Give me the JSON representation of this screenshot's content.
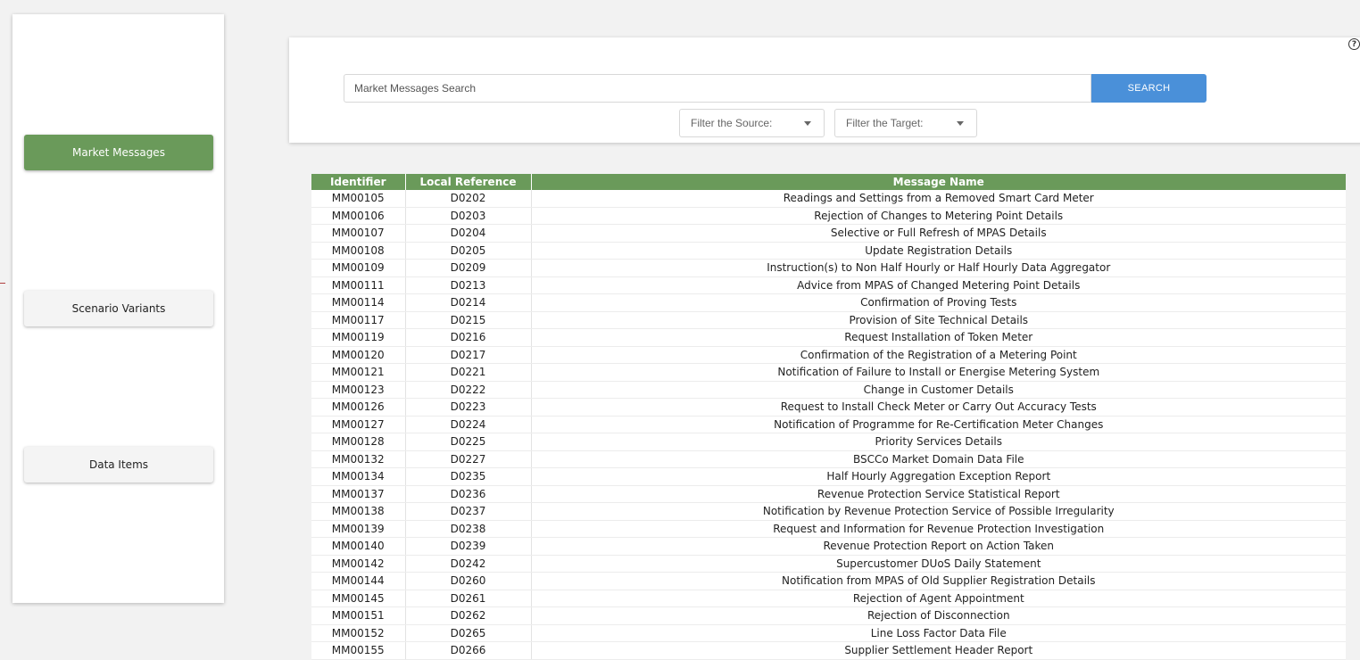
{
  "sidebar": {
    "items": [
      {
        "label": "Market Messages",
        "active": true
      },
      {
        "label": "Scenario Variants",
        "active": false
      },
      {
        "label": "Data Items",
        "active": false
      }
    ]
  },
  "search": {
    "placeholder": "Market Messages Search",
    "button_label": "SEARCH",
    "filter_source_label": "Filter the Source:",
    "filter_target_label": "Filter the Target:"
  },
  "help_icon": "help-icon",
  "colors": {
    "accent_green": "#6a9a5a",
    "search_blue": "#4a90d9"
  },
  "table": {
    "columns": [
      "Identifier",
      "Local Reference",
      "Message Name"
    ],
    "rows": [
      [
        "MM00105",
        "D0202",
        "Readings and Settings from a Removed Smart Card Meter"
      ],
      [
        "MM00106",
        "D0203",
        "Rejection of Changes to Metering Point Details"
      ],
      [
        "MM00107",
        "D0204",
        "Selective or Full Refresh of MPAS Details"
      ],
      [
        "MM00108",
        "D0205",
        "Update Registration Details"
      ],
      [
        "MM00109",
        "D0209",
        "Instruction(s) to Non Half Hourly or Half Hourly Data Aggregator"
      ],
      [
        "MM00111",
        "D0213",
        "Advice from MPAS of Changed Metering Point Details"
      ],
      [
        "MM00114",
        "D0214",
        "Confirmation of Proving Tests"
      ],
      [
        "MM00117",
        "D0215",
        "Provision of Site Technical Details"
      ],
      [
        "MM00119",
        "D0216",
        "Request Installation of Token Meter"
      ],
      [
        "MM00120",
        "D0217",
        "Confirmation of the Registration of a Metering Point"
      ],
      [
        "MM00121",
        "D0221",
        "Notification of Failure to Install or Energise Metering System"
      ],
      [
        "MM00123",
        "D0222",
        "Change in Customer Details"
      ],
      [
        "MM00126",
        "D0223",
        "Request to Install Check Meter or Carry Out Accuracy Tests"
      ],
      [
        "MM00127",
        "D0224",
        "Notification of Programme for Re-Certification Meter Changes"
      ],
      [
        "MM00128",
        "D0225",
        "Priority Services Details"
      ],
      [
        "MM00132",
        "D0227",
        "BSCCo Market Domain Data File"
      ],
      [
        "MM00134",
        "D0235",
        "Half Hourly Aggregation Exception Report"
      ],
      [
        "MM00137",
        "D0236",
        "Revenue Protection Service Statistical Report"
      ],
      [
        "MM00138",
        "D0237",
        "Notification by Revenue Protection Service of Possible Irregularity"
      ],
      [
        "MM00139",
        "D0238",
        "Request and Information for Revenue Protection Investigation"
      ],
      [
        "MM00140",
        "D0239",
        "Revenue Protection Report on Action Taken"
      ],
      [
        "MM00142",
        "D0242",
        "Supercustomer DUoS Daily Statement"
      ],
      [
        "MM00144",
        "D0260",
        "Notification from MPAS of Old Supplier Registration Details"
      ],
      [
        "MM00145",
        "D0261",
        "Rejection of Agent Appointment"
      ],
      [
        "MM00151",
        "D0262",
        "Rejection of Disconnection"
      ],
      [
        "MM00152",
        "D0265",
        "Line Loss Factor Data File"
      ],
      [
        "MM00155",
        "D0266",
        "Supplier Settlement Header Report"
      ]
    ]
  }
}
